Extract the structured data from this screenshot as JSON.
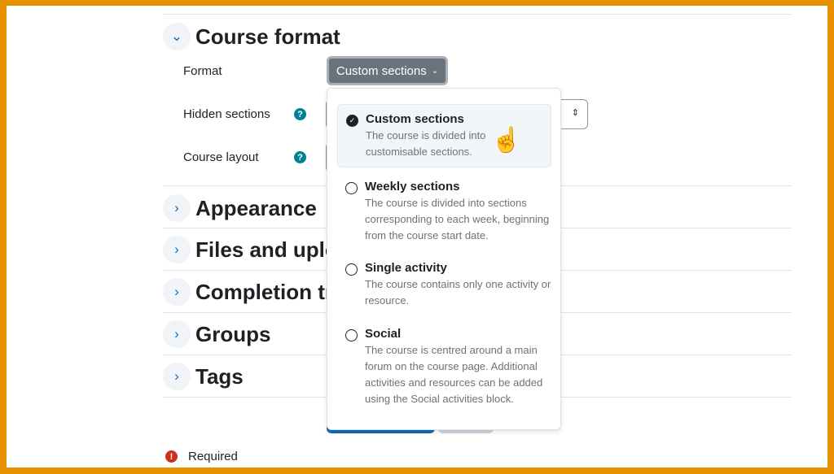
{
  "sections": [
    {
      "title": "Course format",
      "expanded": true
    },
    {
      "title": "Appearance",
      "expanded": false
    },
    {
      "title": "Files and uploads",
      "expanded": false
    },
    {
      "title": "Completion tracking",
      "expanded": false
    },
    {
      "title": "Groups",
      "expanded": false
    },
    {
      "title": "Tags",
      "expanded": false
    }
  ],
  "fields": {
    "format": "Format",
    "hidden_sections": "Hidden sections",
    "course_layout": "Course layout"
  },
  "format_button": "Custom sections",
  "menu": [
    {
      "title": "Custom sections",
      "desc": "The course is divided into customisable sections.",
      "selected": true
    },
    {
      "title": "Weekly sections",
      "desc": "The course is divided into sections corresponding to each week, beginning from the course start date.",
      "selected": false
    },
    {
      "title": "Single activity",
      "desc": "The course contains only one activity or resource.",
      "selected": false
    },
    {
      "title": "Social",
      "desc": "The course is centred around a main forum on the course page. Additional activities and resources can be added using the Social activities block.",
      "selected": false
    }
  ],
  "required": "Required",
  "colors": {
    "frame": "#e88f00",
    "primary": "#0f6cbf",
    "help": "#008196",
    "required": "#ca3120"
  }
}
